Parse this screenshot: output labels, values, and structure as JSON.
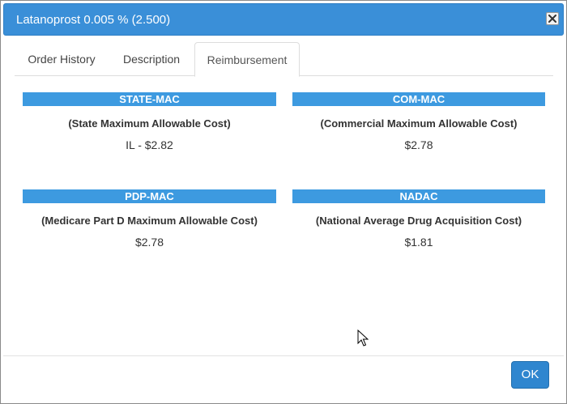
{
  "dialog": {
    "title": "Latanoprost 0.005 % (2.500)",
    "close_icon": "close-icon"
  },
  "tabs": [
    {
      "label": "Order History",
      "active": false
    },
    {
      "label": "Description",
      "active": false
    },
    {
      "label": "Reimbursement",
      "active": true
    }
  ],
  "reimbursement": [
    {
      "code": "STATE-MAC",
      "description": "(State Maximum Allowable Cost)",
      "price": "IL - $2.82"
    },
    {
      "code": "COM-MAC",
      "description": "(Commercial Maximum Allowable Cost)",
      "price": "$2.78"
    },
    {
      "code": "PDP-MAC",
      "description": "(Medicare Part D Maximum Allowable Cost)",
      "price": "$2.78"
    },
    {
      "code": "NADAC",
      "description": "(National Average Drug Acquisition Cost)",
      "price": "$1.81"
    }
  ],
  "footer": {
    "ok_label": "OK"
  },
  "colors": {
    "titlebar": "#3a8fd8",
    "section_bar": "#3d9ae0",
    "ok_button": "#2f86cf"
  }
}
